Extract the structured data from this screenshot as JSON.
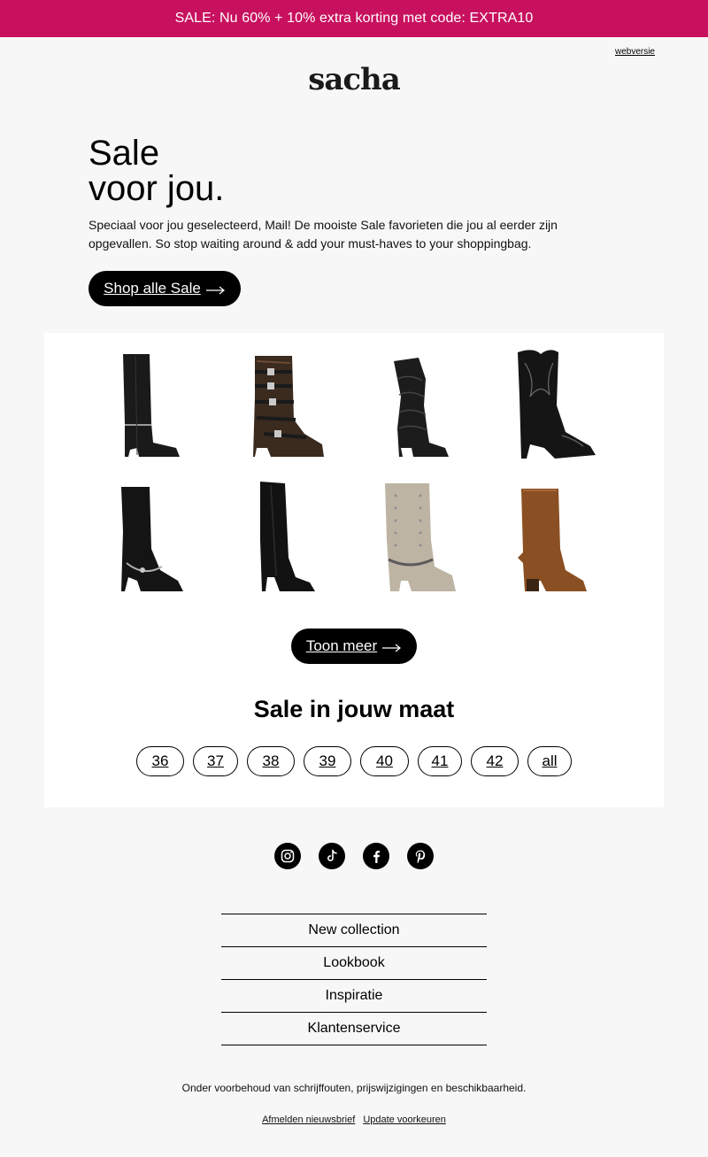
{
  "promo_bar": {
    "text": "SALE: Nu 60% + 10% extra korting met code: EXTRA10",
    "background": "#c8115e"
  },
  "header": {
    "webversie_label": "webversie",
    "logo_text": "sacha"
  },
  "hero": {
    "title_line1": "Sale",
    "title_line2": "voor jou.",
    "text": "Speciaal voor jou geselecteerd, Mail! De mooiste Sale favorieten die jou al eerder zijn opgevallen. So stop waiting around & add your must-haves to your shoppingbag.",
    "cta_label": "Shop alle Sale"
  },
  "products": [
    {
      "icon": "black-zip-knee-boot-image",
      "color": "#1a1a1a"
    },
    {
      "icon": "bronze-buckle-biker-boot-image",
      "color": "#3b2a1e"
    },
    {
      "icon": "black-slouch-boot-image",
      "color": "#1c1c1c"
    },
    {
      "icon": "black-western-boot-image",
      "color": "#151515"
    },
    {
      "icon": "black-harness-boot-image",
      "color": "#141414"
    },
    {
      "icon": "black-tall-boot-image",
      "color": "#121212"
    },
    {
      "icon": "beige-studded-boot-image",
      "color": "#bdb4a3"
    },
    {
      "icon": "cognac-suede-boot-image",
      "color": "#8a4f22"
    }
  ],
  "more_button_label": "Toon meer",
  "size_section": {
    "title": "Sale in jouw maat",
    "sizes": [
      "36",
      "37",
      "38",
      "39",
      "40",
      "41",
      "42",
      "all"
    ]
  },
  "social": [
    "instagram-icon",
    "tiktok-icon",
    "facebook-icon",
    "pinterest-icon"
  ],
  "footer_nav": [
    "New collection",
    "Lookbook",
    "Inspiratie",
    "Klantenservice"
  ],
  "footer": {
    "disclaimer": "Onder voorbehoud van schrijffouten, prijswijzigingen en beschikbaarheid.",
    "unsubscribe_label": "Afmelden nieuwsbrief",
    "preferences_label": "Update voorkeuren"
  }
}
